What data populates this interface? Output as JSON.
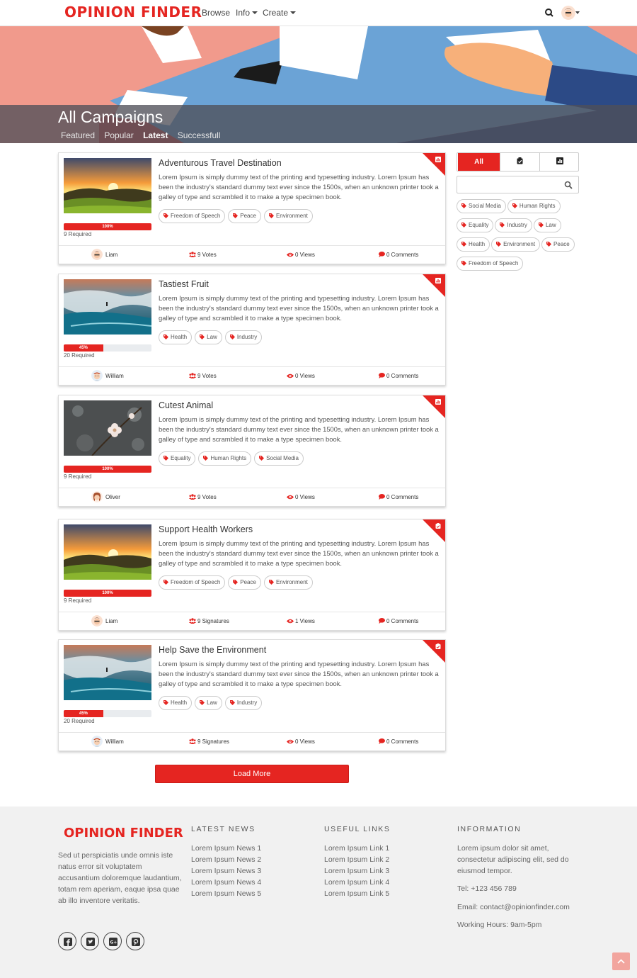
{
  "brand": {
    "name": "OPINION FINDER",
    "accent": "#e52521"
  },
  "nav": {
    "browse": "Browse",
    "info": "Info",
    "create": "Create"
  },
  "hero": {
    "title": "All Campaigns",
    "tabs": [
      "Featured",
      "Popular",
      "Latest",
      "Successfull"
    ],
    "active_tab": "Latest"
  },
  "campaigns": [
    {
      "title": "Adventurous Travel Destination",
      "description": "Lorem Ipsum is simply dummy text of the printing and typesetting industry. Lorem Ipsum has been the industry's standard dummy text ever since the 1500s, when an unknown printer took a galley of type and scrambled it to make a type specimen book.",
      "image": "sunset-meadow",
      "progress": 1.0,
      "progress_label": "100%",
      "required": "9 Required",
      "tags": [
        "Freedom of Speech",
        "Peace",
        "Environment"
      ],
      "author": "Liam",
      "votes": "9 Votes",
      "views": "0 Views",
      "comments": "0 Comments",
      "type_icon": "poll-icon"
    },
    {
      "title": "Tastiest Fruit",
      "description": "Lorem Ipsum is simply dummy text of the printing and typesetting industry. Lorem Ipsum has been the industry's standard dummy text ever since the 1500s, when an unknown printer took a galley of type and scrambled it to make a type specimen book.",
      "image": "surfer-wave",
      "progress": 0.45,
      "progress_label": "45%",
      "required": "20 Required",
      "tags": [
        "Health",
        "Law",
        "Industry"
      ],
      "author": "William",
      "votes": "9 Votes",
      "views": "0 Views",
      "comments": "0 Comments",
      "type_icon": "poll-icon"
    },
    {
      "title": "Cutest Animal",
      "description": "Lorem Ipsum is simply dummy text of the printing and typesetting industry. Lorem Ipsum has been the industry's standard dummy text ever since the 1500s, when an unknown printer took a galley of type and scrambled it to make a type specimen book.",
      "image": "blossom-bokeh",
      "progress": 1.0,
      "progress_label": "100%",
      "required": "9 Required",
      "tags": [
        "Equality",
        "Human Rights",
        "Social Media"
      ],
      "author": "Oliver",
      "votes": "9 Votes",
      "views": "0 Views",
      "comments": "0 Comments",
      "type_icon": "poll-icon"
    },
    {
      "title": "Support Health Workers",
      "description": "Lorem Ipsum is simply dummy text of the printing and typesetting industry. Lorem Ipsum has been the industry's standard dummy text ever since the 1500s, when an unknown printer took a galley of type and scrambled it to make a type specimen book.",
      "image": "sunset-meadow",
      "progress": 1.0,
      "progress_label": "100%",
      "required": "9 Required",
      "tags": [
        "Freedom of Speech",
        "Peace",
        "Environment"
      ],
      "author": "Liam",
      "votes": "9 Signatures",
      "views": "1 Views",
      "comments": "0 Comments",
      "type_icon": "petition-icon"
    },
    {
      "title": "Help Save the Environment",
      "description": "Lorem Ipsum is simply dummy text of the printing and typesetting industry. Lorem Ipsum has been the industry's standard dummy text ever since the 1500s, when an unknown printer took a galley of type and scrambled it to make a type specimen book.",
      "image": "surfer-wave",
      "progress": 0.45,
      "progress_label": "45%",
      "required": "20 Required",
      "tags": [
        "Health",
        "Law",
        "Industry"
      ],
      "author": "William",
      "votes": "9 Signatures",
      "views": "0 Views",
      "comments": "0 Comments",
      "type_icon": "petition-icon"
    }
  ],
  "load_more": "Load More",
  "filter": {
    "all_label": "All",
    "search_placeholder": "",
    "tags": [
      "Social Media",
      "Human Rights",
      "Equality",
      "Industry",
      "Law",
      "Health",
      "Environment",
      "Peace",
      "Freedom of Speech"
    ]
  },
  "footer": {
    "about": "Sed ut perspiciatis unde omnis iste natus error sit voluptatem accusantium doloremque laudantium, totam rem aperiam, eaque ipsa quae ab illo inventore veritatis.",
    "news_heading": "LATEST NEWS",
    "news": [
      "Lorem Ipsum News 1",
      "Lorem Ipsum News 2",
      "Lorem Ipsum News 3",
      "Lorem Ipsum News 4",
      "Lorem Ipsum News 5"
    ],
    "links_heading": "USEFUL LINKS",
    "links": [
      "Lorem Ipsum Link 1",
      "Lorem Ipsum Link 2",
      "Lorem Ipsum Link 3",
      "Lorem Ipsum Link 4",
      "Lorem Ipsum Link 5"
    ],
    "info_heading": "INFORMATION",
    "info_text": "Lorem ipsum dolor sit amet, consectetur adipiscing elit, sed do eiusmod tempor.",
    "tel": "Tel: +123 456 789",
    "email": "Email: contact@opinionfinder.com",
    "hours": "Working Hours: 9am-5pm",
    "social": [
      "facebook-icon",
      "twitter-icon",
      "google-plus-icon",
      "pinterest-icon"
    ]
  }
}
